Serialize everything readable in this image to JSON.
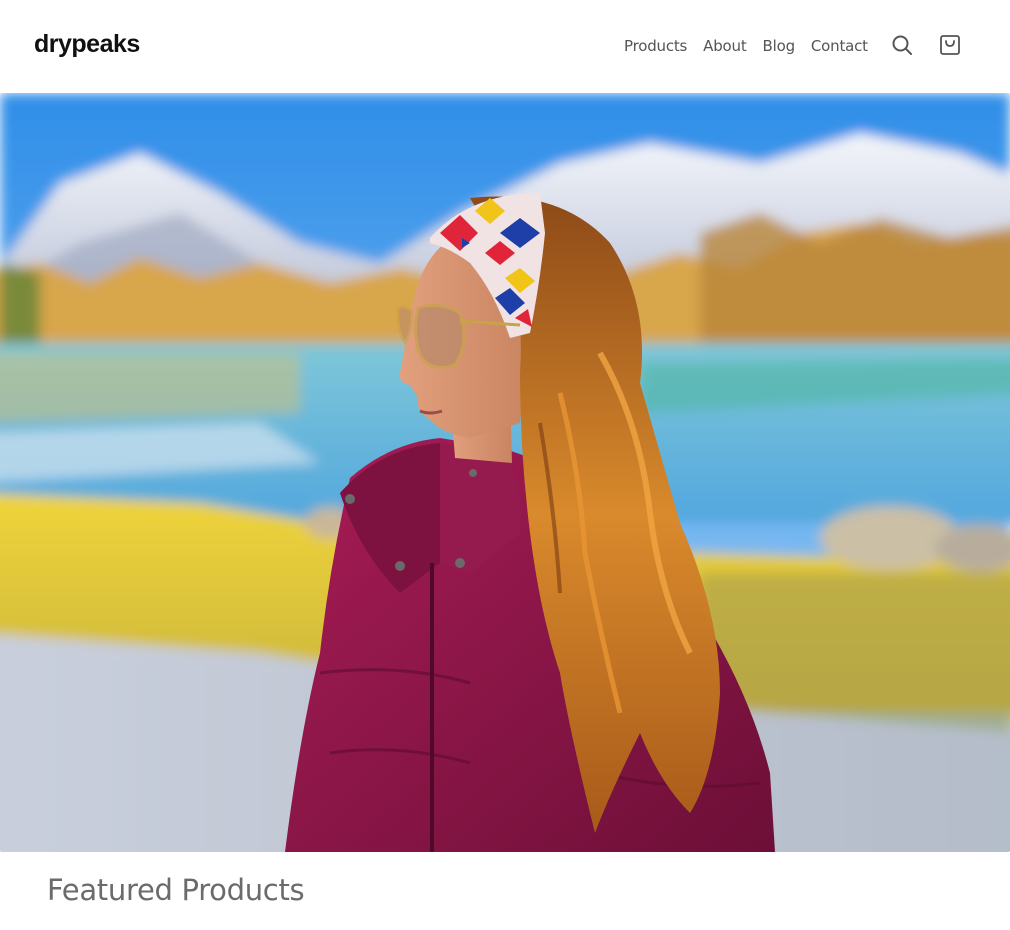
{
  "header": {
    "logo_text": "drypeaks",
    "nav": [
      {
        "label": "Products"
      },
      {
        "label": "About"
      },
      {
        "label": "Blog"
      },
      {
        "label": "Contact"
      }
    ],
    "icons": {
      "search": "search-icon",
      "cart": "shopping-bag-icon"
    }
  },
  "hero": {
    "image": "woman-in-maroon-puffer-jacket-with-patterned-headband-by-mountain-lake",
    "colors": {
      "sky": "#4da6f0",
      "jacket": "#8e1746",
      "hair": "#c9701f",
      "grass": "#e6d23a"
    }
  },
  "featured": {
    "title": "Featured Products"
  }
}
